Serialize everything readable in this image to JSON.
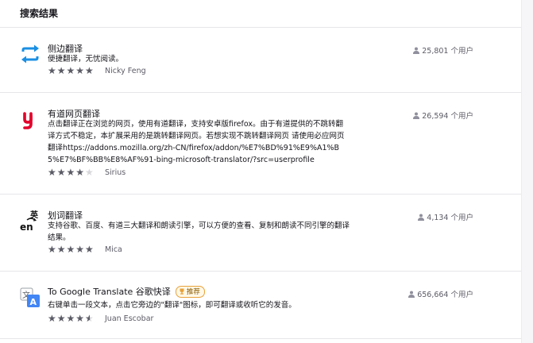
{
  "header": {
    "title": "搜索结果"
  },
  "results": [
    {
      "name": "侧边翻译",
      "description": "便捷翻译，无忧阅读。",
      "rating": 4.5,
      "author": "Nicky Feng",
      "users": "25,801 个用户",
      "icon": "sync-arrows-icon",
      "accent": "#1a8fe3"
    },
    {
      "name": "有道网页翻译",
      "description": "点击翻译正在浏览的网页，使用有道翻译，支持安卓版firefox。由于有道提供的不跳转翻译方式不稳定，本扩展采用的是跳转翻译网页。若想实现不跳转翻译网页 请使用必应网页翻译https://addons.mozilla.org/zh-CN/firefox/addon/%E7%BD%91%E9%A1%B5%E7%BF%BB%E8%AF%91-bing-microsoft-translator/?src=userprofile",
      "rating": 3.5,
      "author": "Sirius",
      "users": "26,594 个用户",
      "icon": "youdao-y-icon",
      "accent": "#e3002b"
    },
    {
      "name": "划词翻译",
      "description": "支持谷歌、百度、有道三大翻译和朗读引擎，可以方便的查看、复制和朗读不同引擎的翻译结果。",
      "rating": 5,
      "author": "Mica",
      "users": "4,134 个用户",
      "icon": "en-translate-icon",
      "accent": "#111111"
    },
    {
      "name": "To Google Translate 谷歌快译",
      "badge": "推荐",
      "description": "右键单击一段文本，点击它旁边的\"翻译\"图标，即可翻译或收听它的发音。",
      "rating": 4,
      "author": "Juan Escobar",
      "users": "656,664 个用户",
      "icon": "google-translate-icon",
      "accent": "#4285f4"
    }
  ]
}
